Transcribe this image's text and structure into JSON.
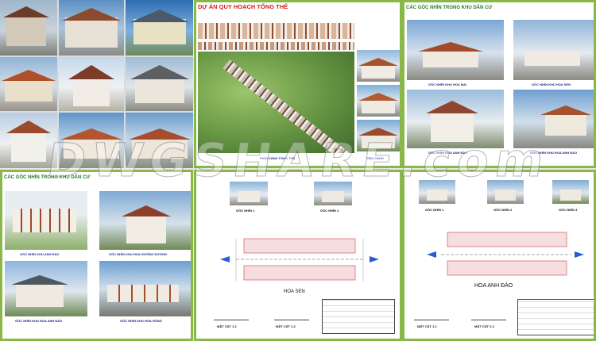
{
  "panel_master": {
    "title": "DỰ ÁN QUY HOẠCH TỔNG THỂ",
    "caption_main": "PHỐI CẢNH TỔNG THỂ",
    "caption_side": "TIỂU CẢNH"
  },
  "panel_views_1": {
    "title": "CÁC GÓC NHÌN TRONG KHU DÂN CƯ",
    "captions": [
      "GÓC NHÌN KHU HOA MAI",
      "GÓC NHÌN KHU HOA SEN",
      "GÓC NHÌN KHU ANH ĐÀO",
      "GÓC NHÌN KHU HOA ANH ĐÀO"
    ]
  },
  "panel_views_2": {
    "title": "CÁC GÓC NHÌN TRONG KHU DÂN CƯ",
    "captions": [
      "GÓC NHÌN KHU ANH ĐÀO",
      "GÓC NHÌN KHU HOA HƯỚNG DƯƠNG",
      "GÓC NHÌN KHU HOA ANH ĐÀO",
      "GÓC NHÌN KHU HOA HỒNG"
    ]
  },
  "panel_hoa_sen": {
    "views": [
      "GÓC NHÌN 1",
      "GÓC NHÌN 2"
    ],
    "name": "HOA SEN",
    "sections": [
      "MẶT CẮT 1-1",
      "MẶT CẮT 2-2"
    ]
  },
  "panel_hoa_anh_dao": {
    "views": [
      "GÓC NHÌN 1",
      "GÓC NHÌN 2",
      "GÓC NHÌN 3"
    ],
    "name": "HOA ANH ĐÀO",
    "sections": [
      "MẶT CẮT 1-1",
      "MẶT CẮT 2-2"
    ]
  },
  "watermark": "DWGSHARE.com",
  "colors": {
    "frame_green": "#8ab848",
    "caption_blue": "#1a2a8a",
    "title_red": "#d42020"
  }
}
